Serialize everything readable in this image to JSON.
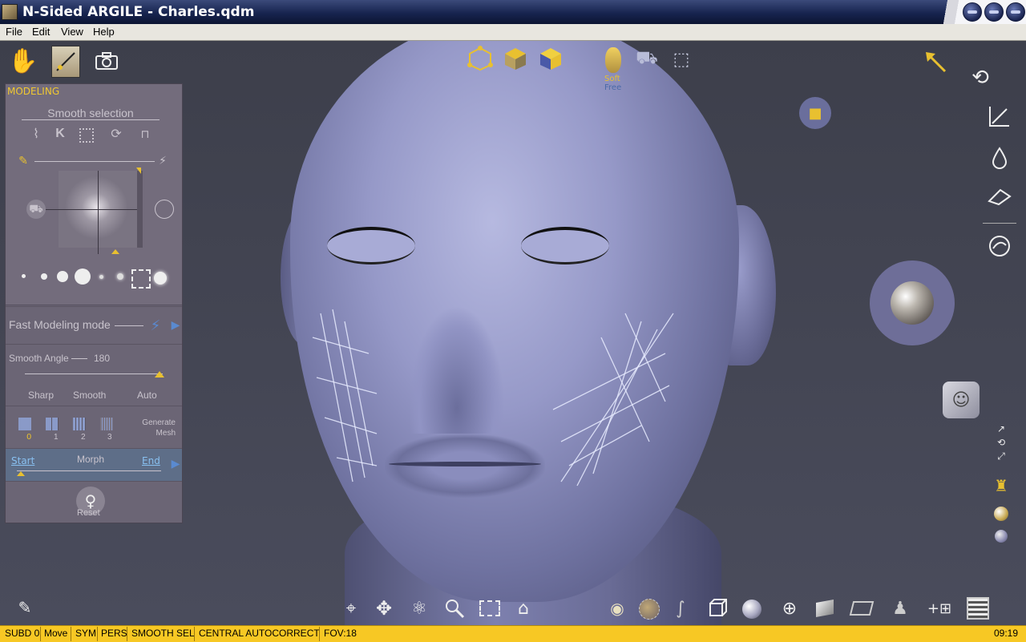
{
  "window": {
    "title": "N-Sided ARGILE - Charles.qdm"
  },
  "menu": [
    "File",
    "Edit",
    "View",
    "Help"
  ],
  "panel": {
    "title": "MODELING",
    "smooth_selection_label": "Smooth selection",
    "fast_modeling_label": "Fast Modeling mode",
    "smooth_angle_label": "Smooth Angle",
    "smooth_angle_value": "180",
    "angle_options": [
      "Sharp",
      "Smooth",
      "Auto"
    ],
    "subdiv_levels": [
      "0",
      "1",
      "2",
      "3"
    ],
    "generate_mesh_label": "Generate Mesh",
    "morph": {
      "start": "Start",
      "label": "Morph",
      "end": "End"
    },
    "reset_label": "Reset"
  },
  "top_toolbar": {
    "soft_label": "Soft",
    "free_label": "Free"
  },
  "status": {
    "items": [
      "SUBD 0",
      "Move",
      "SYM",
      "PERS",
      "SMOOTH SEL",
      "CENTRAL AUTOCORRECT",
      "FOV:18"
    ],
    "time": "09:19"
  },
  "colors": {
    "accent": "#f0c830",
    "status_bg": "#f7c824",
    "panel_bg": "#6b6575",
    "title_bg": "#17244f"
  },
  "icons": {
    "left_top": [
      "hand-icon",
      "brush-icon",
      "camera-icon"
    ],
    "selection": [
      "lasso-icon",
      "k-select-icon",
      "rect-select-icon",
      "refresh-icon",
      "lock-icon"
    ],
    "top_center": [
      "vertex-mode-icon",
      "edge-mode-icon",
      "face-mode-icon"
    ],
    "top_right_center": [
      "mask-icon",
      "video-camera-icon",
      "perspective-icon"
    ],
    "right": [
      "arrow-icon",
      "rotate-icon",
      "scale-icon",
      "drop-icon",
      "eraser-icon",
      "swirl-icon"
    ],
    "bottom": [
      "pin-icon",
      "move-icon",
      "orbit-icon",
      "zoom-icon",
      "frame-icon",
      "home-icon",
      "eye-icon",
      "globe-icon",
      "curve-icon",
      "box-icon",
      "sphere-icon",
      "wire-sphere-icon",
      "texture-icon",
      "plane-icon",
      "figure-icon",
      "add-grid-icon",
      "film-icon"
    ]
  }
}
